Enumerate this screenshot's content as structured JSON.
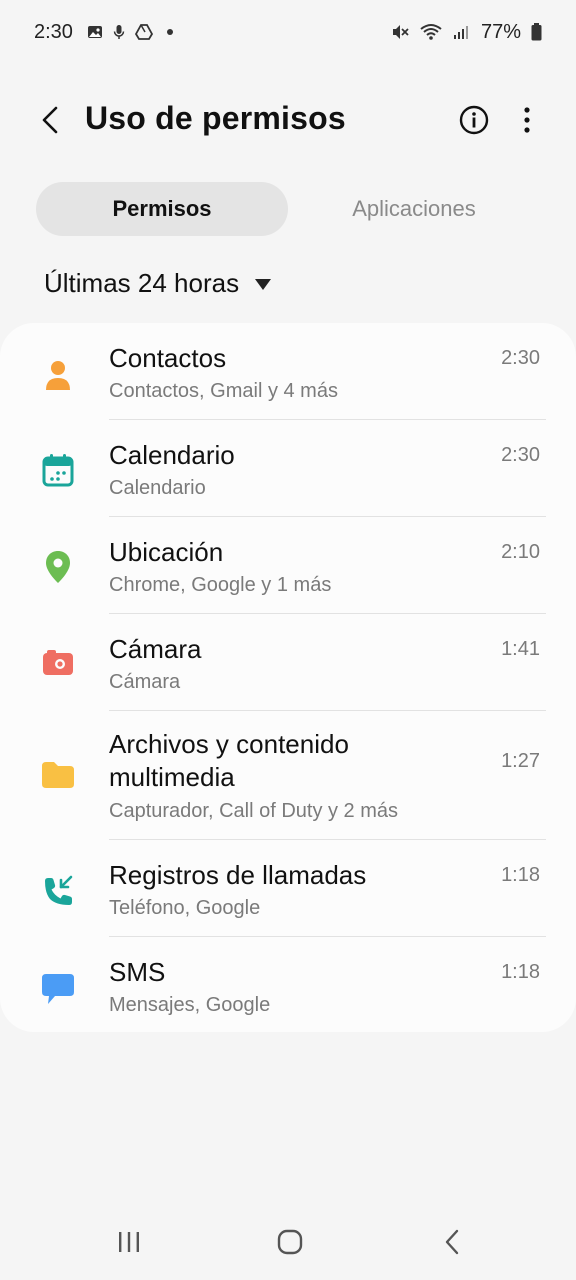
{
  "status_bar": {
    "time": "2:30",
    "battery": "77%",
    "icons": [
      "image-icon",
      "mic-icon",
      "drive-icon",
      "dot-icon",
      "mute-icon",
      "wifi-icon",
      "signal-icon",
      "battery-icon"
    ]
  },
  "header": {
    "title": "Uso de permisos",
    "back_icon": "back-arrow-icon",
    "info_icon": "info-icon",
    "more_icon": "more-vert-icon"
  },
  "tabs": [
    {
      "label": "Permisos",
      "active": true
    },
    {
      "label": "Aplicaciones",
      "active": false
    }
  ],
  "filter": {
    "label": "Últimas 24 horas"
  },
  "permissions": [
    {
      "title": "Contactos",
      "subtitle": "Contactos, Gmail y 4 más",
      "time": "2:30",
      "icon": "contacts-icon",
      "color": "#f6a03a"
    },
    {
      "title": "Calendario",
      "subtitle": "Calendario",
      "time": "2:30",
      "icon": "calendar-icon",
      "color": "#1aa59a"
    },
    {
      "title": "Ubicación",
      "subtitle": "Chrome, Google y 1 más",
      "time": "2:10",
      "icon": "location-icon",
      "color": "#6cbd52"
    },
    {
      "title": "Cámara",
      "subtitle": "Cámara",
      "time": "1:41",
      "icon": "camera-icon",
      "color": "#ef6e62"
    },
    {
      "title_line1": "Archivos y contenido",
      "title_line2": "multimedia",
      "subtitle": "Capturador, Call of Duty y 2 más",
      "time": "1:27",
      "icon": "folder-icon",
      "color": "#f9c043"
    },
    {
      "title": "Registros de llamadas",
      "subtitle": "Teléfono, Google",
      "time": "1:18",
      "icon": "call-log-icon",
      "color": "#1aa59a"
    },
    {
      "title": "SMS",
      "subtitle": "Mensajes, Google",
      "time": "1:18",
      "icon": "sms-icon",
      "color": "#4b9cf5"
    }
  ],
  "navbar": {
    "recents_icon": "recents-icon",
    "home_icon": "home-icon",
    "back_icon": "nav-back-icon"
  }
}
